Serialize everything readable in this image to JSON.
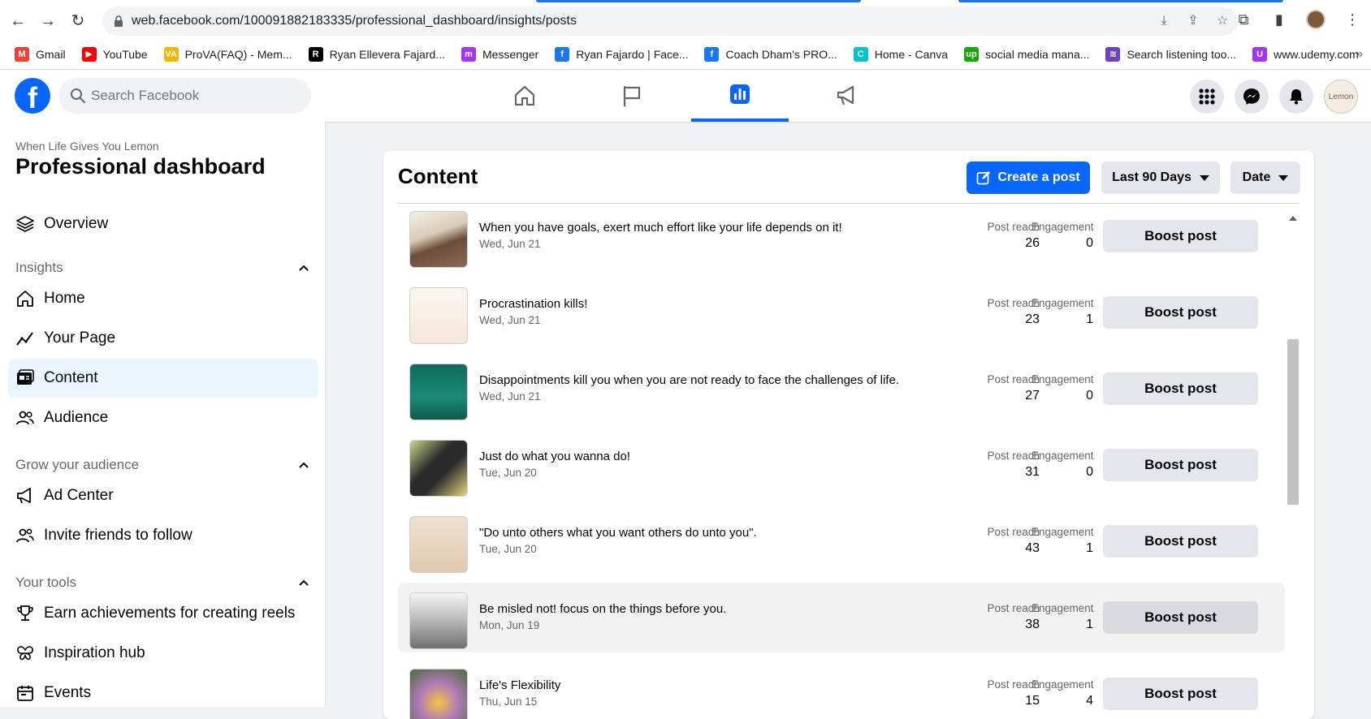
{
  "browser": {
    "url": "web.facebook.com/100091882183335/professional_dashboard/insights/posts",
    "bookmarks": [
      {
        "label": "Gmail",
        "color": "#ea4335",
        "glyph": "M"
      },
      {
        "label": "YouTube",
        "color": "#ff0000",
        "glyph": "▶"
      },
      {
        "label": "ProVA(FAQ) - Mem...",
        "color": "#f4b400",
        "glyph": "VA"
      },
      {
        "label": "Ryan Ellevera Fajard...",
        "color": "#000000",
        "glyph": "R"
      },
      {
        "label": "Messenger",
        "color": "#a334fa",
        "glyph": "m"
      },
      {
        "label": "Ryan Fajardo | Face...",
        "color": "#1877f2",
        "glyph": "f"
      },
      {
        "label": "Coach Dham's PRO...",
        "color": "#1877f2",
        "glyph": "f"
      },
      {
        "label": "Home - Canva",
        "color": "#00c4cc",
        "glyph": "C"
      },
      {
        "label": "social media mana...",
        "color": "#14a800",
        "glyph": "up"
      },
      {
        "label": "Search listening too...",
        "color": "#6f42c1",
        "glyph": "≋"
      },
      {
        "label": "www.udemy.com",
        "color": "#a435f0",
        "glyph": "U"
      }
    ],
    "more": "»"
  },
  "facebook": {
    "search_placeholder": "Search Facebook",
    "logo": "f",
    "avatar_text": "Lemon"
  },
  "sidebar": {
    "page_name": "When Life Gives You Lemon",
    "title": "Professional dashboard",
    "overview": "Overview",
    "sections": {
      "insights": "Insights",
      "grow": "Grow your audience",
      "tools": "Your tools"
    },
    "insights_items": [
      "Home",
      "Your Page",
      "Content",
      "Audience"
    ],
    "grow_items": [
      "Ad Center",
      "Invite friends to follow"
    ],
    "tools_items": [
      "Earn achievements for creating reels",
      "Inspiration hub",
      "Events"
    ]
  },
  "content": {
    "title": "Content",
    "create_post": "Create a post",
    "range_filter": "Last 90 Days",
    "sort_filter": "Date",
    "metric_reach_label": "Post reach",
    "metric_engagement_label": "Engagement",
    "boost_label": "Boost post",
    "posts": [
      {
        "title": "When you have goals, exert much effort like your life depends on it!",
        "date": "Wed, Jun 21",
        "reach": "26",
        "engagement": "0"
      },
      {
        "title": "Procrastination kills!",
        "date": "Wed, Jun 21",
        "reach": "23",
        "engagement": "1"
      },
      {
        "title": "Disappointments kill you when you are not ready to face the challenges of life.",
        "date": "Wed, Jun 21",
        "reach": "27",
        "engagement": "0"
      },
      {
        "title": "Just do what you wanna do!",
        "date": "Tue, Jun 20",
        "reach": "31",
        "engagement": "0"
      },
      {
        "title": "\"Do unto others what you want others do unto you\".",
        "date": "Tue, Jun 20",
        "reach": "43",
        "engagement": "1"
      },
      {
        "title": "Be misled not! focus on the things before you.",
        "date": "Mon, Jun 19",
        "reach": "38",
        "engagement": "1"
      },
      {
        "title": "Life's Flexibility",
        "date": "Thu, Jun 15",
        "reach": "15",
        "engagement": "4"
      }
    ]
  },
  "colors": {
    "brand": "#0866ff",
    "active_bg": "#ebf5ff",
    "button_gray": "#e4e6eb"
  }
}
